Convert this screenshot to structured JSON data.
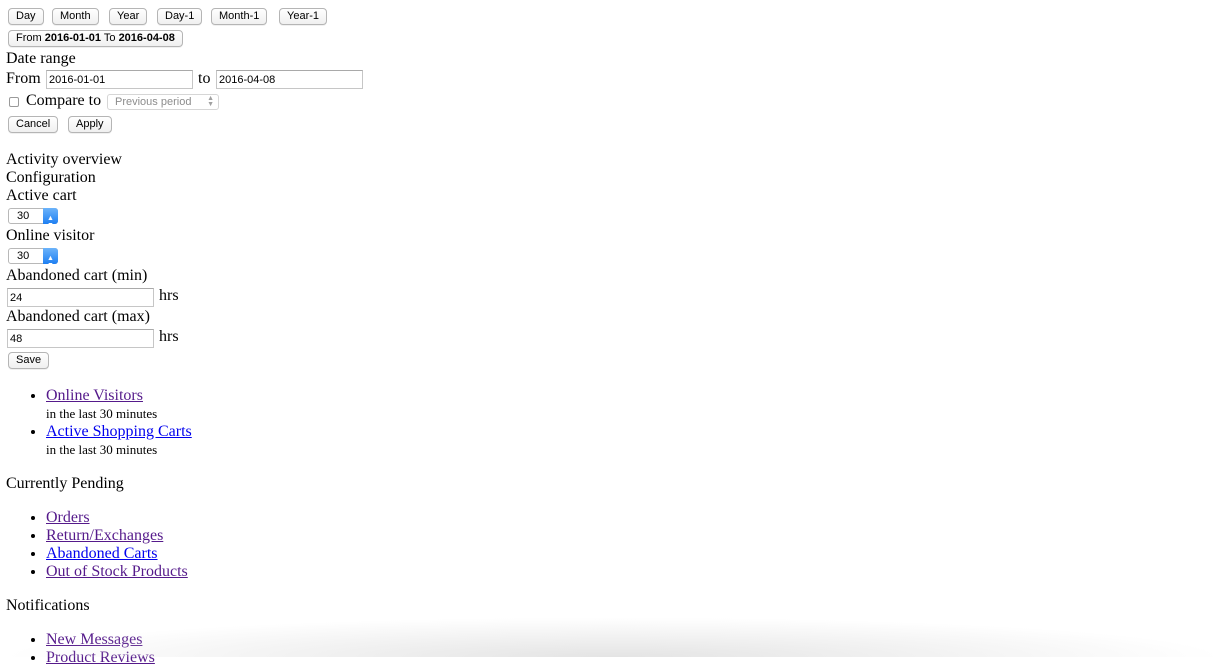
{
  "range_buttons": [
    "Day",
    "Month",
    "Year",
    "Day-1",
    "Month-1",
    "Year-1"
  ],
  "range_toggle": {
    "from_word": "From",
    "from_date": "2016-01-01",
    "to_word": "To",
    "to_date": "2016-04-08"
  },
  "date_range": {
    "title": "Date range",
    "from_label": "From",
    "from_value": "2016-01-01",
    "to_label": "to",
    "to_value": "2016-04-08",
    "compare_label": "Compare to",
    "compare_checked": false,
    "compare_select": "Previous period",
    "cancel_label": "Cancel",
    "apply_label": "Apply"
  },
  "activity": {
    "title": "Activity overview",
    "config_title": "Configuration",
    "active_cart_label": "Active cart",
    "active_cart_value": "30",
    "online_visitor_label": "Online visitor",
    "online_visitor_value": "30",
    "abandoned_min_label": "Abandoned cart (min)",
    "abandoned_min_value": "24",
    "abandoned_max_label": "Abandoned cart (max)",
    "abandoned_max_value": "48",
    "hrs_unit": "hrs",
    "save_label": "Save"
  },
  "live_items": [
    {
      "label": "Online Visitors",
      "sub": "in the last 30 minutes"
    },
    {
      "label": "Active Shopping Carts",
      "sub": "in the last 30 minutes"
    }
  ],
  "pending": {
    "title": "Currently Pending",
    "items": [
      "Orders",
      "Return/Exchanges",
      "Abandoned Carts",
      "Out of Stock Products"
    ]
  },
  "notifications": {
    "title": "Notifications",
    "items": [
      "New Messages",
      "Product Reviews"
    ]
  }
}
